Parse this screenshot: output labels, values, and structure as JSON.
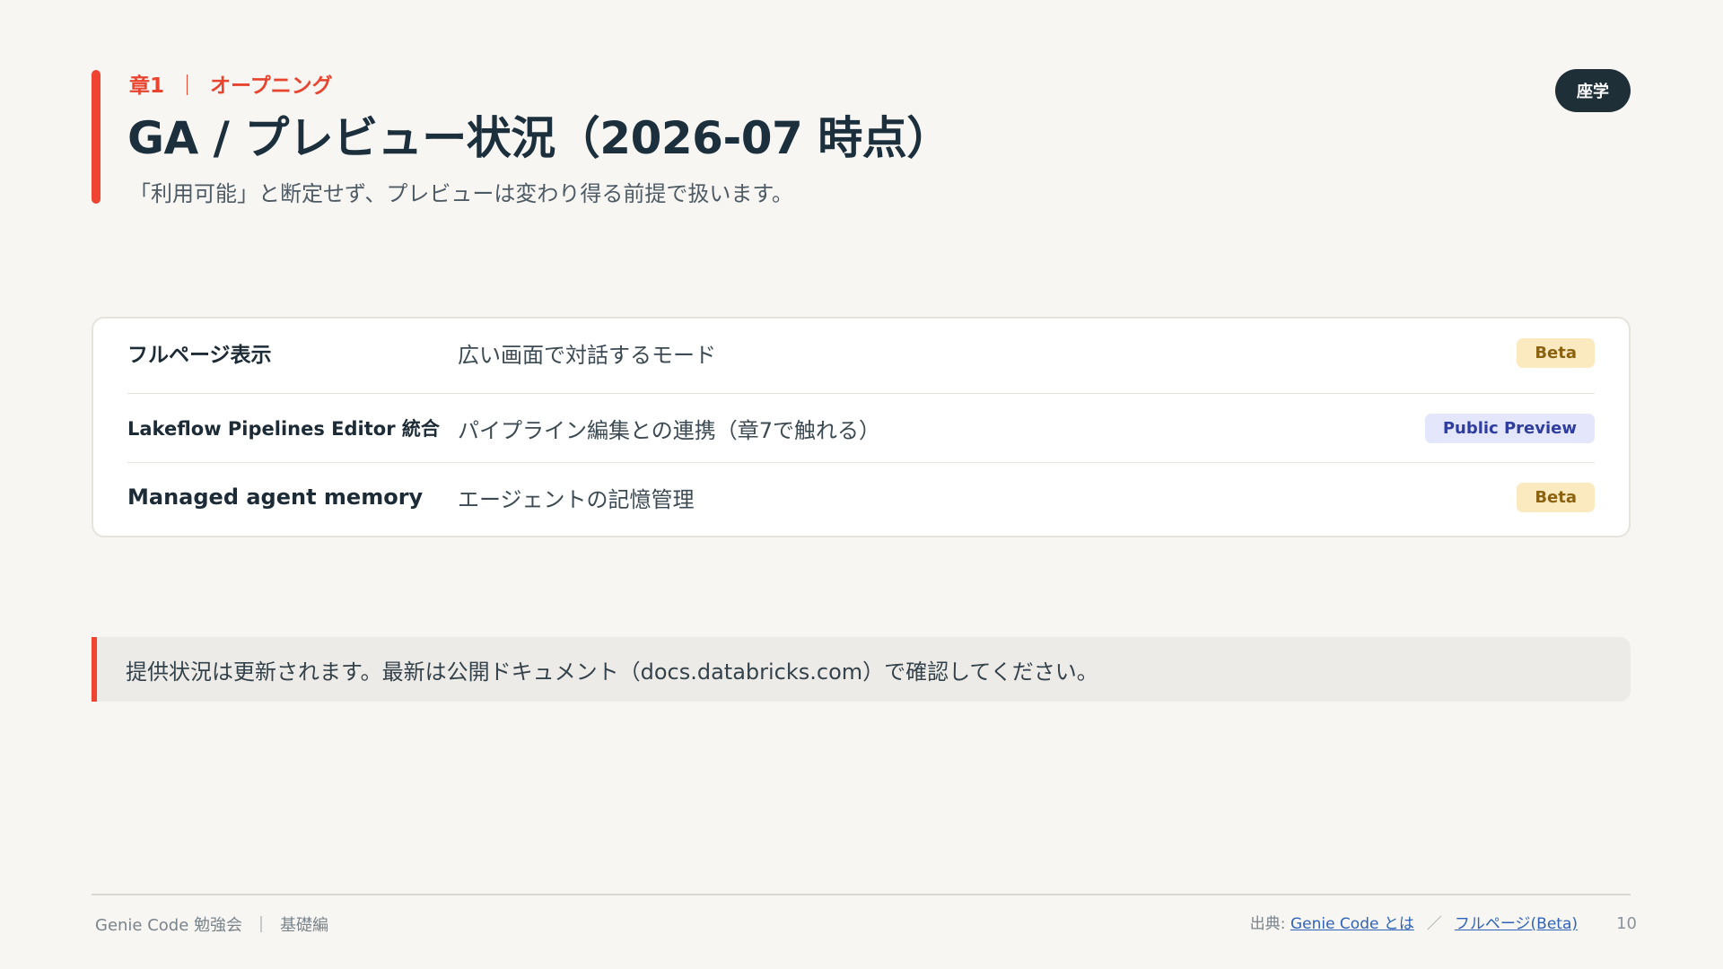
{
  "header": {
    "chapter_label": "章1",
    "chapter_sep": "｜",
    "chapter_title": "オープニング",
    "title": "GA / プレビュー状況（2026-07 時点）",
    "subtitle": "「利用可能」と断定せず、プレビューは変わり得る前提で扱います。",
    "mode_badge": "座学"
  },
  "status_rows": [
    {
      "name": "フルページ表示",
      "description": "広い画面で対話するモード",
      "status": "Beta"
    },
    {
      "name": "Lakeflow Pipelines Editor 統合",
      "description": "パイプライン編集との連携（章7で触れる）",
      "status": "Public Preview"
    },
    {
      "name": "Managed agent memory",
      "description": "エージェントの記憶管理",
      "status": "Beta"
    }
  ],
  "note": "提供状況は更新されます。最新は公開ドキュメント（docs.databricks.com）で確認してください。",
  "footer": {
    "event": "Genie Code 勉強会",
    "sep": "｜",
    "course": "基礎編",
    "sources_label": "出典:",
    "source_1": "Genie Code とは",
    "source_sep": "／",
    "source_2": "フルページ(Beta)",
    "page_number": "10"
  },
  "colors": {
    "accent": "#ef4431",
    "title": "#1c2f3c",
    "beta_bg": "#fbeac0",
    "beta_text": "#8b6310",
    "preview_bg": "#e4e7fb",
    "preview_text": "#2e3d9e"
  }
}
